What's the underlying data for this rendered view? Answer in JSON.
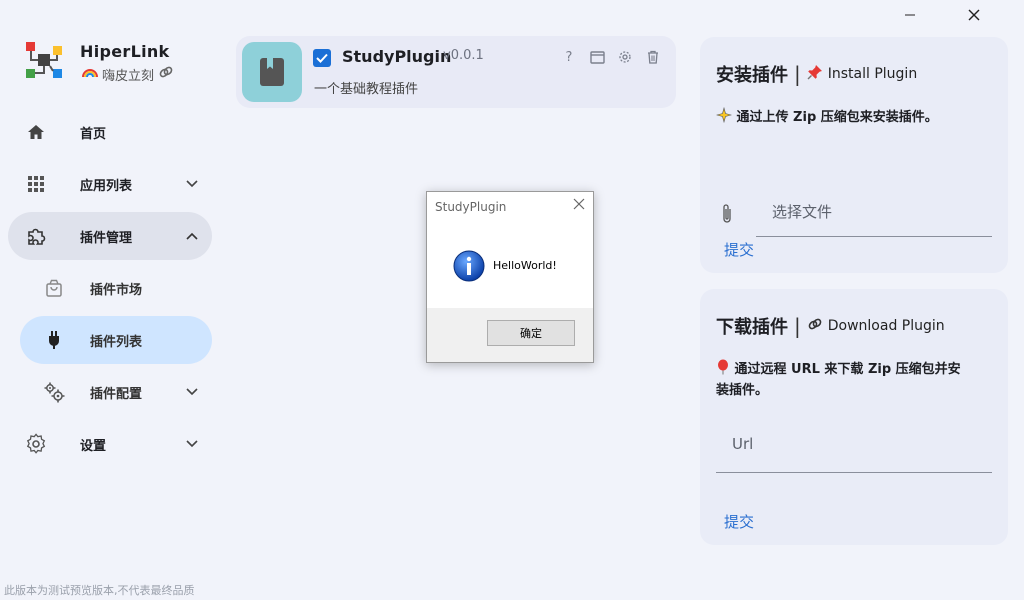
{
  "window": {
    "minimize": "—",
    "close": "✕"
  },
  "app": {
    "title": "HiperLink",
    "subtitle": "嗨皮立刻"
  },
  "nav": [
    {
      "label": "首页",
      "icon": "home-icon"
    },
    {
      "label": "应用列表",
      "icon": "apps-grid-icon"
    },
    {
      "label": "插件管理",
      "icon": "puzzle-icon"
    },
    {
      "label": "插件市场",
      "icon": "shopping-bag-icon"
    },
    {
      "label": "插件列表",
      "icon": "plug-icon"
    },
    {
      "label": "插件配置",
      "icon": "gears-icon"
    },
    {
      "label": "设置",
      "icon": "settings-icon"
    }
  ],
  "footer_note": "此版本为测试预览版本,不代表最终品质",
  "plugin": {
    "name": "StudyPlugin",
    "version": "v0.0.1",
    "description": "一个基础教程插件",
    "enabled": true
  },
  "dialog": {
    "title": "StudyPlugin",
    "message": "HelloWorld!",
    "ok": "确定"
  },
  "install": {
    "title": "安装插件",
    "separator": "|",
    "title_en": "Install Plugin",
    "description": "通过上传 Zip 压缩包来安装插件。",
    "file_placeholder": "选择文件",
    "submit": "提交"
  },
  "download": {
    "title": "下载插件",
    "separator": "|",
    "title_en": "Download Plugin",
    "description_line1": "通过远程 URL 来下载 Zip 压缩包并安",
    "description_line2": "装插件。",
    "url_placeholder": "Url",
    "submit": "提交"
  },
  "colors": {
    "background": "#f1f3fa",
    "accent": "#1a6fd6",
    "active_nav": "#cfe5ff",
    "plugin_icon_bg": "#8ed0d9",
    "link": "#2a6fd0"
  }
}
